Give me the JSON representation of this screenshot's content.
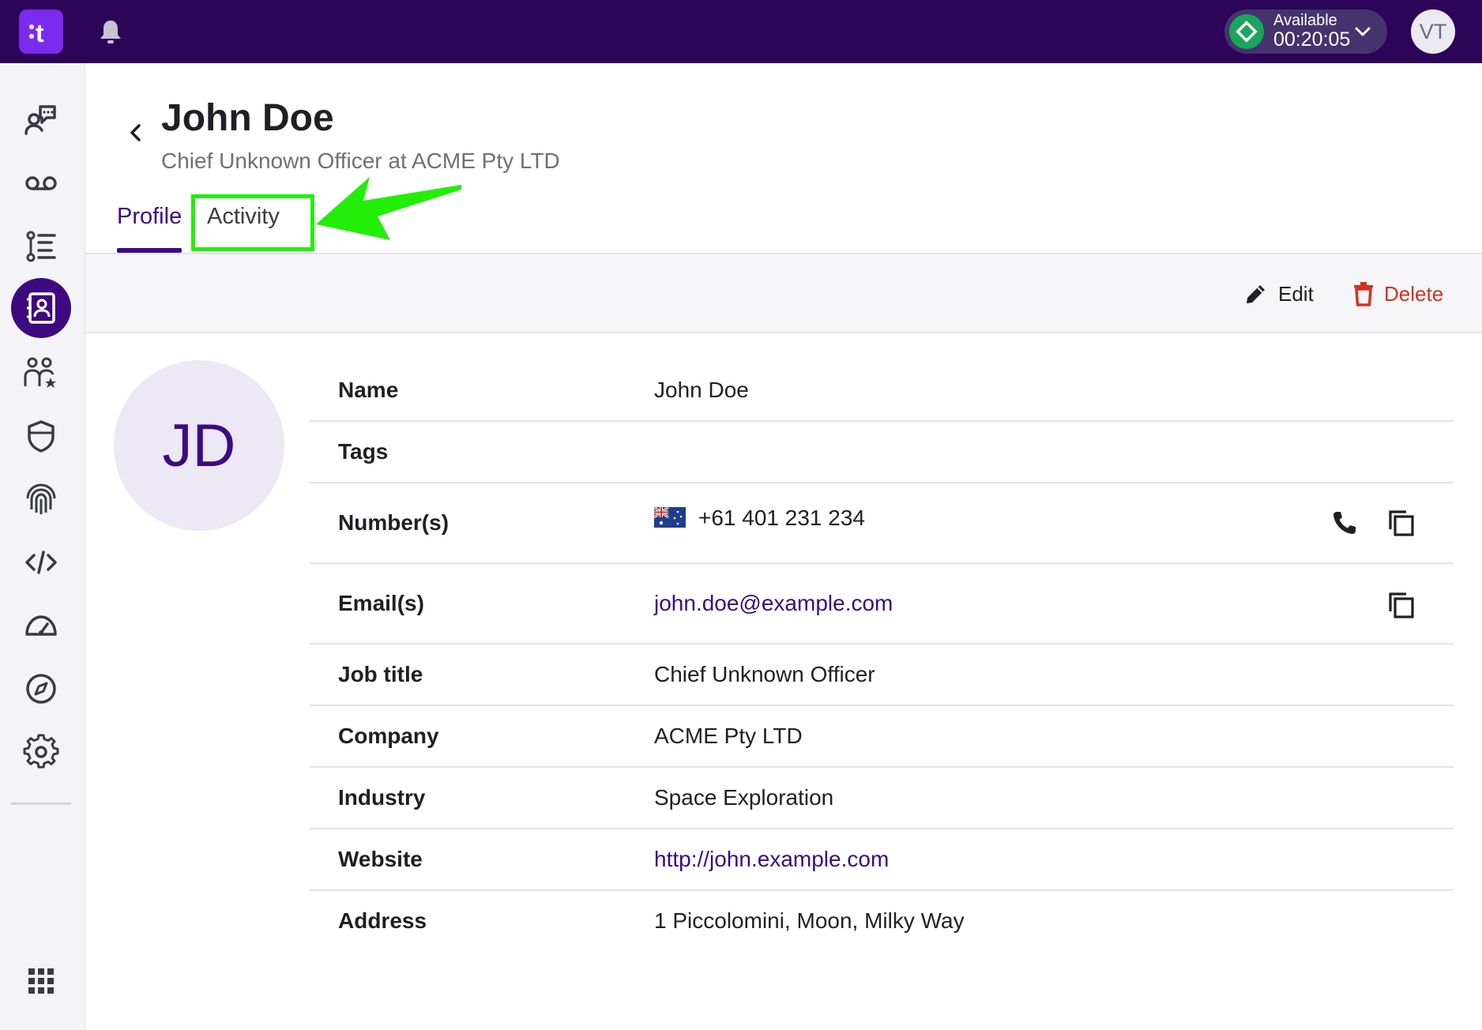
{
  "header": {
    "logo_letter": "t",
    "status_label": "Available",
    "status_timer": "00:20:05",
    "user_initials": "VT",
    "brand_color": "#2c0458",
    "status_color": "#1aa65a"
  },
  "sidebar": {
    "items": [
      {
        "icon": "conversations-icon"
      },
      {
        "icon": "voicemail-icon"
      },
      {
        "icon": "list-icon"
      },
      {
        "icon": "contacts-icon",
        "active": true
      },
      {
        "icon": "team-star-icon"
      },
      {
        "icon": "shield-icon"
      },
      {
        "icon": "fingerprint-icon"
      },
      {
        "icon": "code-icon"
      },
      {
        "icon": "speedometer-icon"
      },
      {
        "icon": "compass-icon"
      },
      {
        "icon": "settings-icon"
      },
      {
        "icon": "apps-grid-icon"
      }
    ]
  },
  "contact": {
    "name": "John Doe",
    "subtitle": "Chief Unknown Officer at ACME Pty LTD",
    "initials": "JD"
  },
  "tabs": [
    {
      "label": "Profile",
      "active": true
    },
    {
      "label": "Activity",
      "active": false
    }
  ],
  "toolbar": {
    "edit_label": "Edit",
    "delete_label": "Delete"
  },
  "details": {
    "name": {
      "label": "Name",
      "value": "John Doe"
    },
    "tags": {
      "label": "Tags",
      "value": ""
    },
    "numbers": {
      "label": "Number(s)",
      "value": "+61 401 231 234",
      "flag": "australia-flag"
    },
    "emails": {
      "label": "Email(s)",
      "value": "john.doe@example.com"
    },
    "job_title": {
      "label": "Job title",
      "value": "Chief Unknown Officer"
    },
    "company": {
      "label": "Company",
      "value": "ACME Pty LTD"
    },
    "industry": {
      "label": "Industry",
      "value": "Space Exploration"
    },
    "website": {
      "label": "Website",
      "value": "http://john.example.com"
    },
    "address": {
      "label": "Address",
      "value": "1 Piccolomini, Moon, Milky Way"
    }
  },
  "annotation": {
    "color": "#22ee08"
  }
}
